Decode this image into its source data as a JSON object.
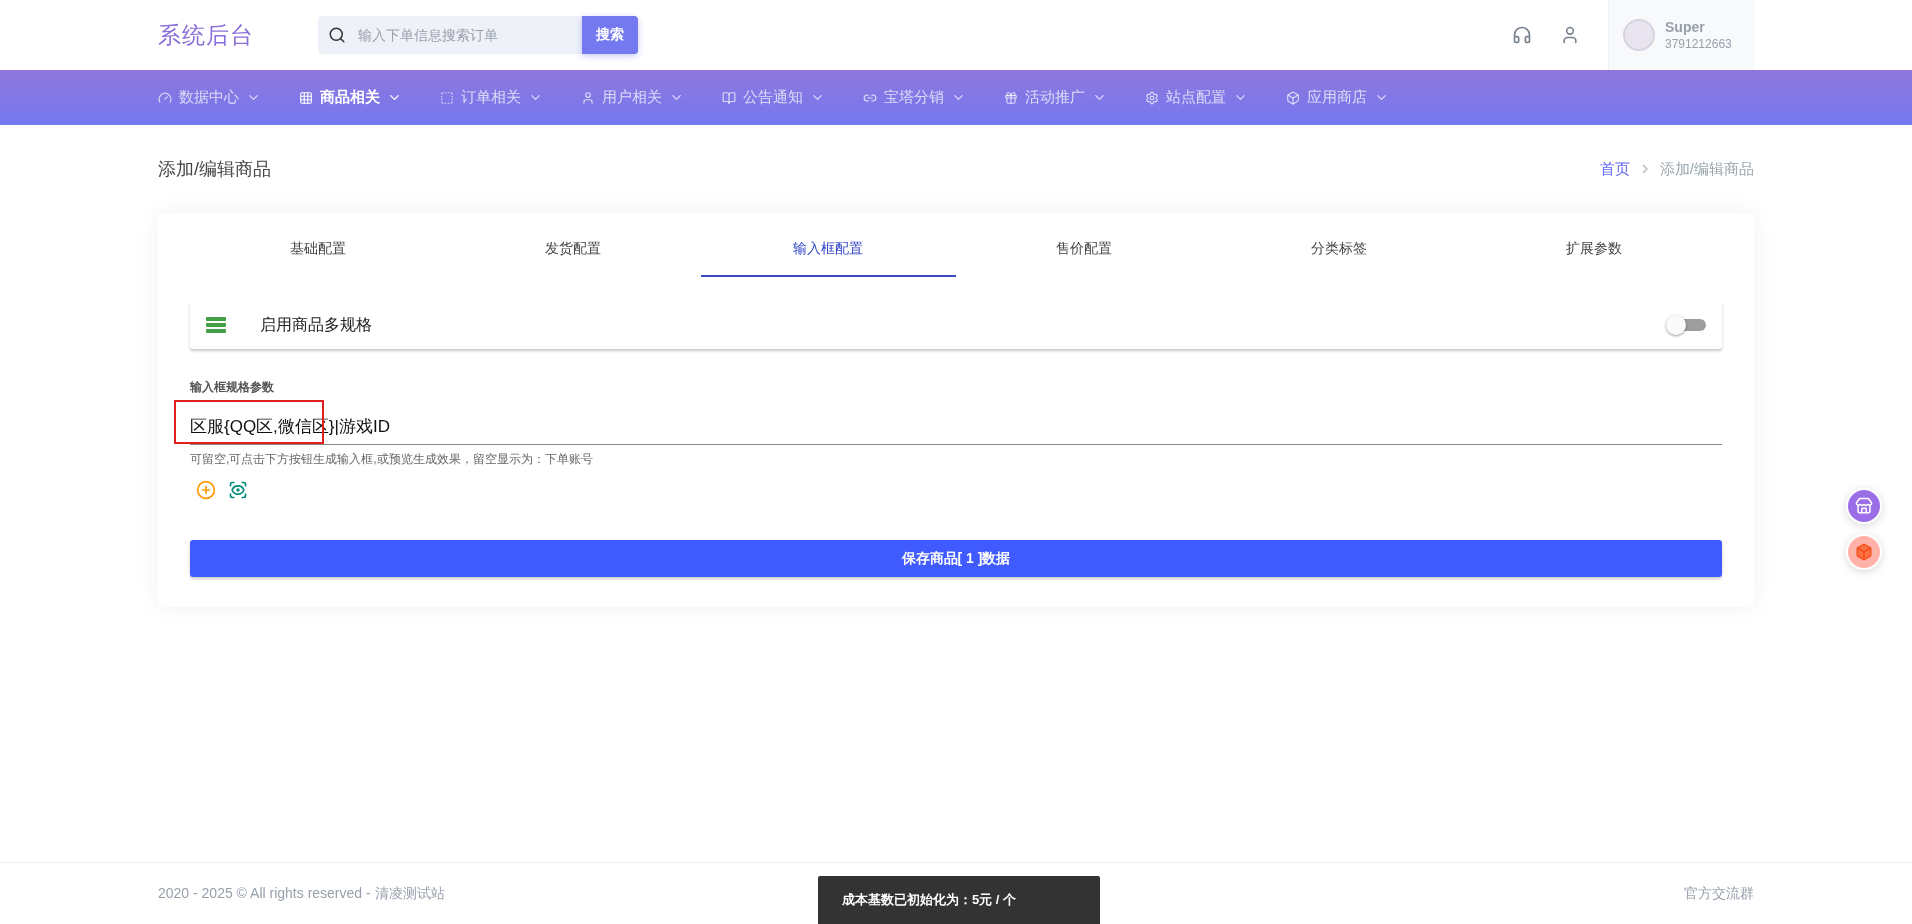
{
  "header": {
    "logo": "系统后台",
    "search": {
      "placeholder": "输入下单信息搜索订单",
      "button": "搜索"
    },
    "user": {
      "name": "Super",
      "id": "3791212663"
    }
  },
  "nav": [
    {
      "label": "数据中心",
      "selected": false
    },
    {
      "label": "商品相关",
      "selected": true
    },
    {
      "label": "订单相关",
      "selected": false
    },
    {
      "label": "用户相关",
      "selected": false
    },
    {
      "label": "公告通知",
      "selected": false
    },
    {
      "label": "宝塔分销",
      "selected": false
    },
    {
      "label": "活动推广",
      "selected": false
    },
    {
      "label": "站点配置",
      "selected": false
    },
    {
      "label": "应用商店",
      "selected": false
    }
  ],
  "page_title": "添加/编辑商品",
  "breadcrumb": [
    {
      "label": "首页",
      "selected": false
    },
    {
      "label": "添加/编辑商品",
      "selected": true
    }
  ],
  "tabs": [
    {
      "label": "基础配置",
      "selected": false
    },
    {
      "label": "发货配置",
      "selected": false
    },
    {
      "label": "输入框配置",
      "selected": true
    },
    {
      "label": "售价配置",
      "selected": false
    },
    {
      "label": "分类标签",
      "selected": false
    },
    {
      "label": "扩展参数",
      "selected": false
    }
  ],
  "multi_spec": {
    "label": "启用商品多规格",
    "on": false
  },
  "field": {
    "label": "输入框规格参数",
    "value": "区服{QQ区,微信区}|游戏ID",
    "hint": "可留空,可点击下方按钮生成输入框,或预览生成效果，留空显示为：下单账号"
  },
  "save_button": "保存商品[ 1 ]数据",
  "footer": {
    "copyright": "2020 - 2025 © All rights reserved - ",
    "site": "清凌测试站",
    "link": "官方交流群"
  },
  "toast": "成本基数已初始化为：5元 / 个"
}
